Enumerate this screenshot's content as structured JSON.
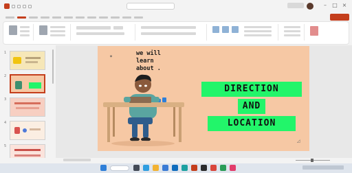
{
  "slide": {
    "heading_line1": "we will learn",
    "heading_line2": "about .",
    "title_lines": [
      "DIRECTION",
      "AND",
      "LOCATION"
    ],
    "background_color": "#f6c8a4",
    "title_fill_color": "#22f56a",
    "title_text_color": "#111111"
  },
  "thumbnails": {
    "numbers": [
      "1",
      "2",
      "3",
      "4",
      "5"
    ],
    "selected_index": 1
  },
  "icons": {
    "app": "powerpoint-icon",
    "start": "windows-start-icon",
    "search": "search-icon",
    "user": "avatar-icon"
  },
  "colors": {
    "accent": "#c43e1c",
    "taskbar": "#dfe5ed"
  }
}
